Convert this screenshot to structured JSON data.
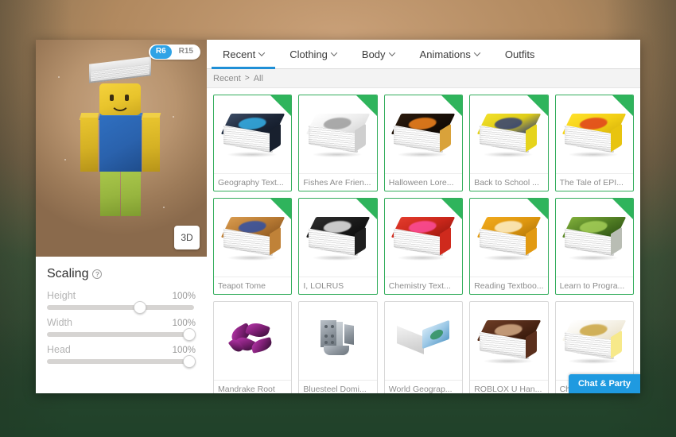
{
  "window": {
    "left_panel": {
      "rig_toggle": {
        "options": [
          "R6",
          "R15"
        ],
        "selected": "R6"
      },
      "view_button": "3D",
      "scaling": {
        "title": "Scaling",
        "help_icon": "?",
        "sliders": [
          {
            "label": "Height",
            "value": "100%",
            "knob_pct": 63
          },
          {
            "label": "Width",
            "value": "100%",
            "knob_pct": 97
          },
          {
            "label": "Head",
            "value": "100%",
            "knob_pct": 97
          }
        ]
      }
    },
    "right_panel": {
      "tabs": [
        {
          "label": "Recent",
          "has_chevron": true,
          "active": true
        },
        {
          "label": "Clothing",
          "has_chevron": true,
          "active": false
        },
        {
          "label": "Body",
          "has_chevron": true,
          "active": false
        },
        {
          "label": "Animations",
          "has_chevron": true,
          "active": false
        },
        {
          "label": "Outfits",
          "has_chevron": false,
          "active": false
        }
      ],
      "breadcrumb": {
        "root": "Recent",
        "separator": ">",
        "current": "All"
      },
      "items": [
        {
          "label": "Geography Text...",
          "owned": true,
          "kind": "book",
          "cover": "linear-gradient(150deg,#3a4a63 0%,#1d2738 55%,#121a28 100%)",
          "spine": "#18202e",
          "accent": "#35b6f0"
        },
        {
          "label": "Fishes Are Frien...",
          "owned": true,
          "kind": "book",
          "cover": "linear-gradient(150deg,#ffffff 0%,#ededed 55%,#d6d6d6 100%)",
          "spine": "#cfcfcf",
          "accent": "#9a9a9a"
        },
        {
          "label": "Halloween Lore...",
          "owned": true,
          "kind": "book",
          "cover": "linear-gradient(150deg,#2a1a0c 0%,#1a1008 50%,#0d0805 100%)",
          "spine": "#d9a23a",
          "accent": "#ff8a1f"
        },
        {
          "label": "Back to School ...",
          "owned": true,
          "kind": "book",
          "cover": "linear-gradient(150deg,#f2e02a 0%,#dfcd18 50%,#2b3a7a 100%)",
          "spine": "#e6d41c",
          "accent": "#2b3a7a"
        },
        {
          "label": "The Tale of EPI...",
          "owned": true,
          "kind": "book",
          "cover": "linear-gradient(150deg,#ffe12a 0%,#f2cf15 55%,#d9b50c 100%)",
          "spine": "#e8c40f",
          "accent": "#e03b1d"
        },
        {
          "label": "Teapot Tome",
          "owned": true,
          "kind": "book",
          "cover": "linear-gradient(150deg,#d79a4e 0%,#b87a33 50%,#8f5a22 100%)",
          "spine": "#c08238",
          "accent": "#2b4ea8"
        },
        {
          "label": "I, LOLRUS",
          "owned": true,
          "kind": "book",
          "cover": "linear-gradient(150deg,#2d2d2d 0%,#1a1a1a 55%,#0d0d0d 100%)",
          "spine": "#1f1f1f",
          "accent": "#efefef"
        },
        {
          "label": "Chemistry Text...",
          "owned": true,
          "kind": "book",
          "cover": "linear-gradient(150deg,#e23b2c 0%,#c8261a 55%,#9c1a10 100%)",
          "spine": "#cf2a1d",
          "accent": "#ff4fa0"
        },
        {
          "label": "Reading Textboo...",
          "owned": true,
          "kind": "book",
          "cover": "linear-gradient(150deg,#f0a91c 0%,#dd960f 55%,#b5790a 100%)",
          "spine": "#e29a12",
          "accent": "#fff3cf"
        },
        {
          "label": "Learn to Progra...",
          "owned": true,
          "kind": "book",
          "cover": "linear-gradient(150deg,#7fae3a 0%,#4e7a22 55%,#2f5414 100%)",
          "spine": "#b9bdb4",
          "accent": "#a8d25a"
        },
        {
          "label": "Mandrake Root",
          "owned": false,
          "kind": "mandrake"
        },
        {
          "label": "Bluesteel Domi...",
          "owned": false,
          "kind": "domino"
        },
        {
          "label": "World Geograp...",
          "owned": false,
          "kind": "flatbook",
          "cover": "linear-gradient(150deg,#cfe6f5 0%,#9cc8e6 50%,#5d9ec9 100%)",
          "accent": "#2f8f5c"
        },
        {
          "label": "ROBLOX U Han...",
          "owned": false,
          "kind": "book",
          "cover": "linear-gradient(150deg,#6b3b24 0%,#4e2716 55%,#331708 100%)",
          "spine": "#5a2f1c",
          "accent": "#d9b08a"
        },
        {
          "label": "Che",
          "owned": false,
          "kind": "book",
          "cover": "linear-gradient(150deg,#ffffff 0%,#f4f0e4 55%,#e8dfc6 100%)",
          "spine": "#f7e98a",
          "accent": "#c9a23a"
        }
      ],
      "chat_party_button": "Chat & Party"
    }
  }
}
